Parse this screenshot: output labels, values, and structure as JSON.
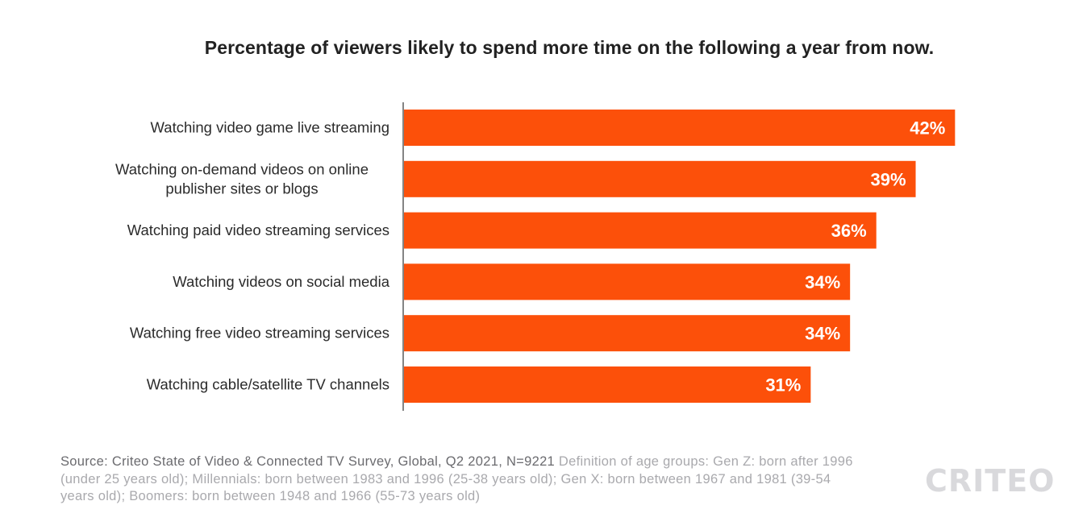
{
  "chart_data": {
    "type": "bar",
    "orientation": "horizontal",
    "title": "Percentage of viewers likely to spend more time on the following a year from now.",
    "categories": [
      [
        "Watching video game live streaming"
      ],
      [
        "Watching on-demand videos on online",
        "publisher sites or blogs"
      ],
      [
        "Watching paid video streaming services"
      ],
      [
        "Watching videos on social media"
      ],
      [
        "Watching free video streaming services"
      ],
      [
        "Watching cable/satellite TV channels"
      ]
    ],
    "values": [
      42,
      39,
      36,
      34,
      34,
      31
    ],
    "value_labels": [
      "42%",
      "39%",
      "36%",
      "34%",
      "34%",
      "31%"
    ],
    "xlabel": "",
    "ylabel": "",
    "xlim": [
      0,
      50
    ],
    "grid": false,
    "legend": "none",
    "bar_color": "#fc500a"
  },
  "footer": {
    "source": "Source: Criteo State of Video & Connected TV Survey, Global, Q2 2021, N=9221",
    "definition": "Definition of age groups: Gen Z: born after 1996 (under 25 years old); Millennials: born between 1983 and 1996 (25-38 years old); Gen X: born between 1967 and 1981 (39-54 years old); Boomers: born between 1948 and 1966 (55-73 years old)"
  },
  "logo": {
    "text": "CRITEO",
    "color": "#d9d9dc"
  }
}
